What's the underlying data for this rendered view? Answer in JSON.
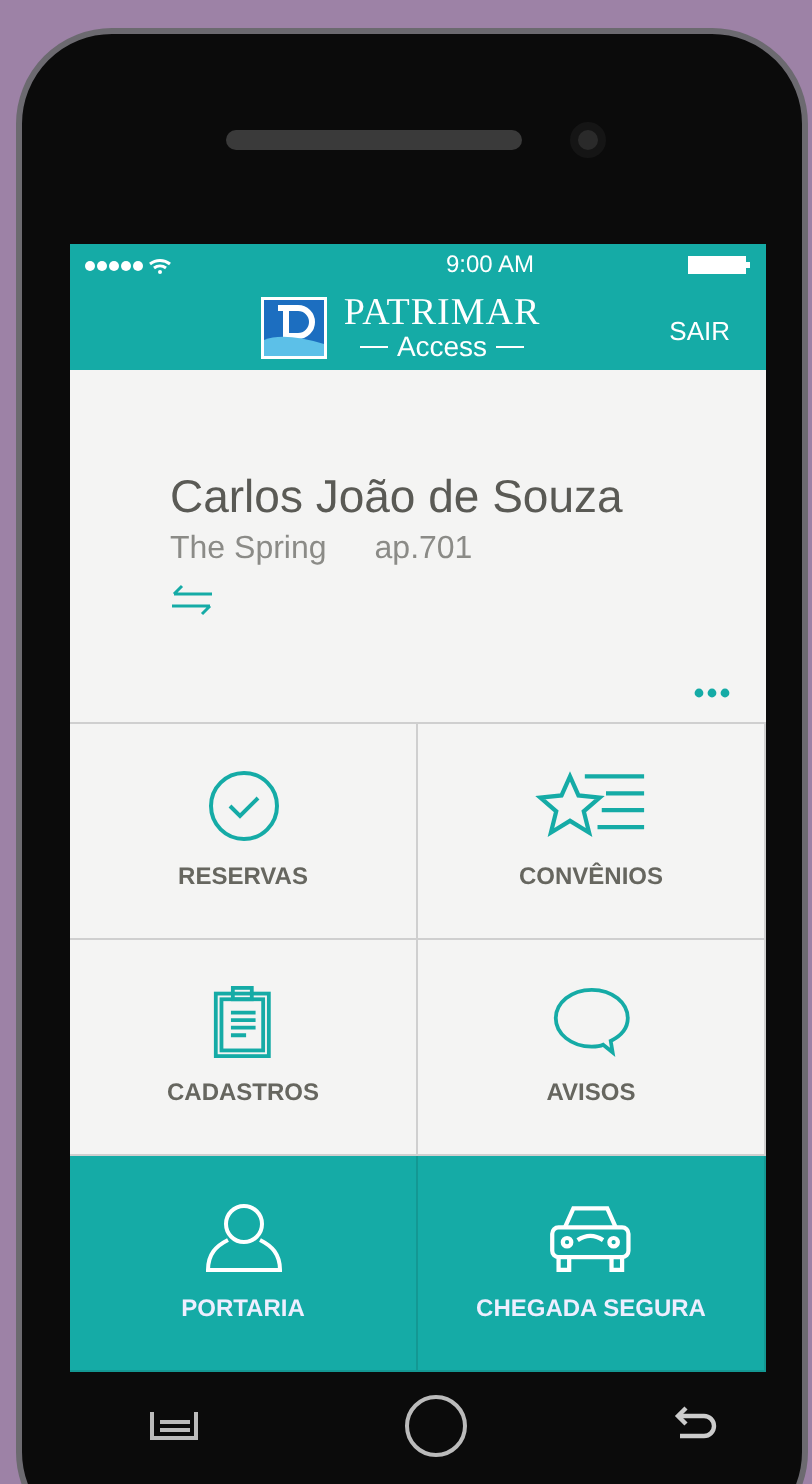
{
  "status_bar": {
    "time": "9:00 AM"
  },
  "header": {
    "logo_title": "PATRIMAR",
    "logo_subtitle": "Access",
    "action": "SAIR"
  },
  "profile": {
    "name": "Carlos João de Souza",
    "building": "The Spring",
    "apartment": "ap.701"
  },
  "tiles": [
    {
      "label": "RESERVAS",
      "kind": "light"
    },
    {
      "label": "CONVÊNIOS",
      "kind": "light"
    },
    {
      "label": "CADASTROS",
      "kind": "light"
    },
    {
      "label": "AVISOS",
      "kind": "light"
    },
    {
      "label": "PORTARIA",
      "kind": "accent"
    },
    {
      "label": "CHEGADA SEGURA",
      "kind": "accent"
    }
  ]
}
